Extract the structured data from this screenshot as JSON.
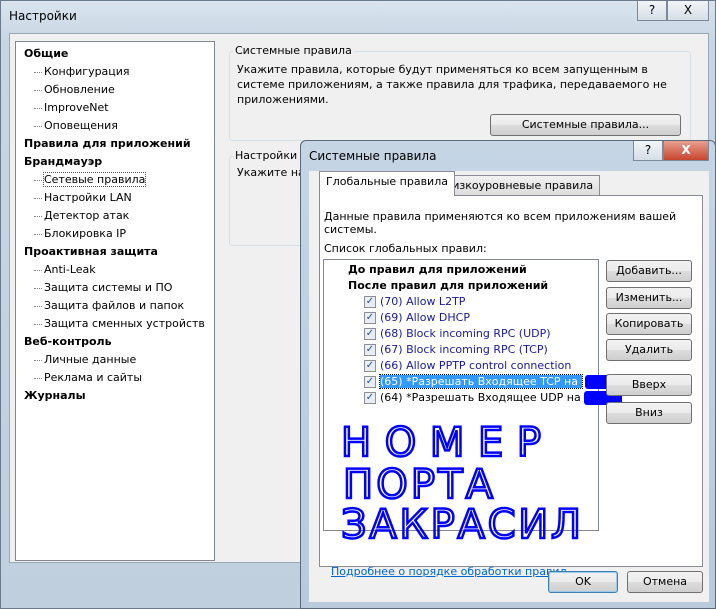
{
  "main": {
    "title": "Настройки",
    "help": "?",
    "close": "X",
    "tree": [
      {
        "label": "Общие",
        "bold": true
      },
      {
        "label": "Конфигурация"
      },
      {
        "label": "Обновление"
      },
      {
        "label": "ImproveNet"
      },
      {
        "label": "Оповещения"
      },
      {
        "label": "Правила для приложений",
        "bold": true
      },
      {
        "label": "Брандмауэр",
        "bold": true
      },
      {
        "label": "Сетевые правила",
        "selected": true
      },
      {
        "label": "Настройки LAN"
      },
      {
        "label": "Детектор атак"
      },
      {
        "label": "Блокировка IP"
      },
      {
        "label": "Проактивная защита",
        "bold": true
      },
      {
        "label": "Anti-Leak"
      },
      {
        "label": "Защита системы и ПО"
      },
      {
        "label": "Защита файлов и папок"
      },
      {
        "label": "Защита сменных устройств"
      },
      {
        "label": "Веб-контроль",
        "bold": true
      },
      {
        "label": "Личные данные"
      },
      {
        "label": "Реклама и сайты"
      },
      {
        "label": "Журналы",
        "bold": true
      }
    ],
    "group1": {
      "label": "Системные правила",
      "text": "Укажите правила, которые будут применяться ко всем запущенным в системе приложениям, а также правила для трафика, передаваемого не приложениями.",
      "button": "Системные правила..."
    },
    "group2": {
      "label": "Настройки IC",
      "text": "Укажите нас"
    }
  },
  "dialog": {
    "title": "Системные правила",
    "help": "?",
    "close": "X",
    "tabs": [
      "Глобальные правила",
      "Низкоуровневые правила"
    ],
    "description": "Данные правила применяются ко всем приложениям вашей системы.",
    "list_label": "Список глобальных правил:",
    "groups": [
      "До правил для приложений",
      "После правил для приложений"
    ],
    "rules": [
      {
        "label": "(70) Allow L2TP",
        "checked": true
      },
      {
        "label": "(69) Allow DHCP",
        "checked": true
      },
      {
        "label": "(68) Block incoming RPC (UDP)",
        "checked": true
      },
      {
        "label": "(67) Block incoming RPC (TCP)",
        "checked": true
      },
      {
        "label": "(66) Allow PPTP control connection",
        "checked": true
      },
      {
        "label": "(65) *Разрешать Входящее TCP на",
        "checked": true
      },
      {
        "label": "(64) *Разрешать Входящее UDP на",
        "checked": true
      }
    ],
    "buttons": {
      "add": "Добавить...",
      "edit": "Изменить...",
      "copy": "Копировать",
      "delete": "Удалить",
      "up": "Вверх",
      "down": "Вниз",
      "ok": "OK",
      "cancel": "Отмена"
    },
    "link": "Подробнее о порядке обработки правил...",
    "handwriting": [
      "НОМЕР",
      "ПОРТА",
      "ЗАКРАСИЛ"
    ],
    "annotation_color": "#0000ff"
  }
}
